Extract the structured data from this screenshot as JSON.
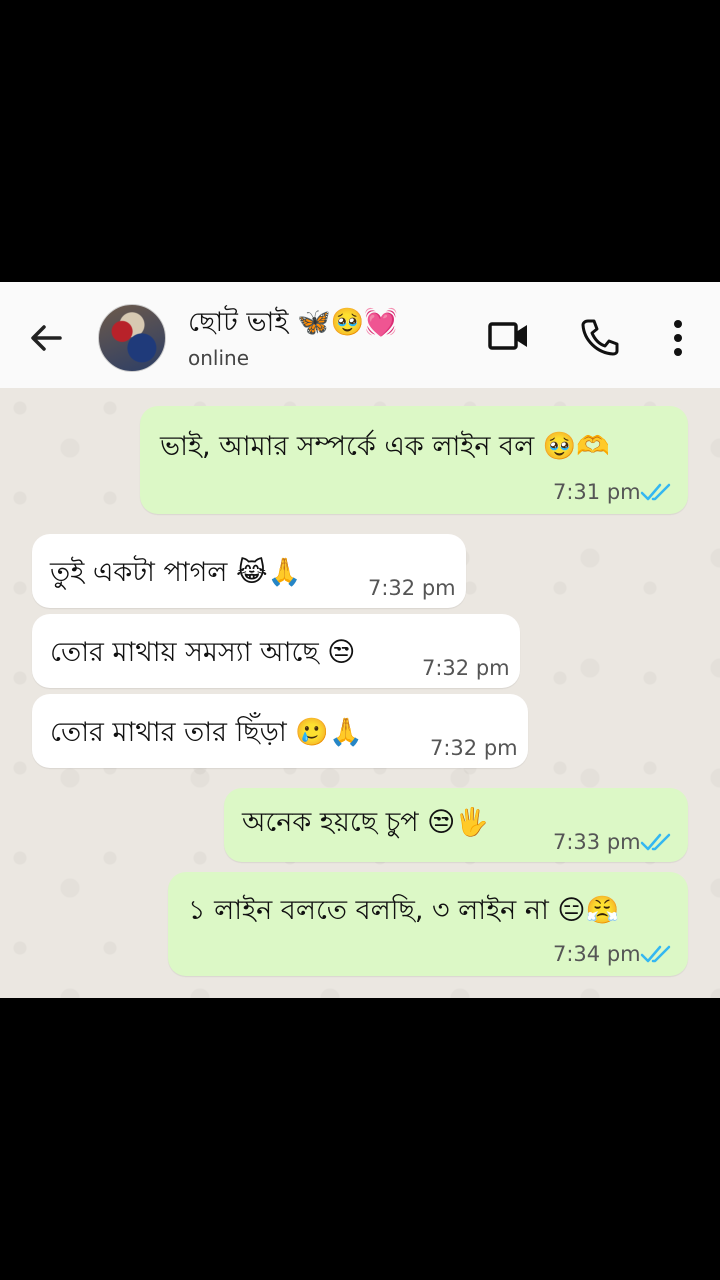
{
  "header": {
    "contact_name": "ছোট ভাই 🦋🥹💓",
    "status": "online",
    "icons": {
      "back": "back-arrow-icon",
      "video": "video-call-icon",
      "voice": "voice-call-icon",
      "menu": "more-options-icon"
    }
  },
  "messages": [
    {
      "direction": "outgoing",
      "text": "ভাই, আমার সম্পর্কে এক লাইন বল 🥹🫶",
      "time": "7:31 pm",
      "read": true
    },
    {
      "direction": "incoming",
      "text": "তুই একটা পাগল 😹🙏",
      "time": "7:32 pm"
    },
    {
      "direction": "incoming",
      "text": "তোর মাথায় সমস্যা আছে 😒",
      "time": "7:32 pm"
    },
    {
      "direction": "incoming",
      "text": "তোর মাথার তার ছিঁড়া 🥲🙏",
      "time": "7:32 pm"
    },
    {
      "direction": "outgoing",
      "text": "অনেক হয়ছে চুপ 😒🖐",
      "time": "7:33 pm",
      "read": true
    },
    {
      "direction": "outgoing",
      "text": "১ লাইন বলতে বলছি, ৩ লাইন না 😑😤",
      "time": "7:34 pm",
      "read": true
    }
  ],
  "colors": {
    "outgoing_bubble": "#dcf8c6",
    "incoming_bubble": "#ffffff",
    "read_ticks": "#34b7f1",
    "wallpaper": "#ebe7e1"
  }
}
